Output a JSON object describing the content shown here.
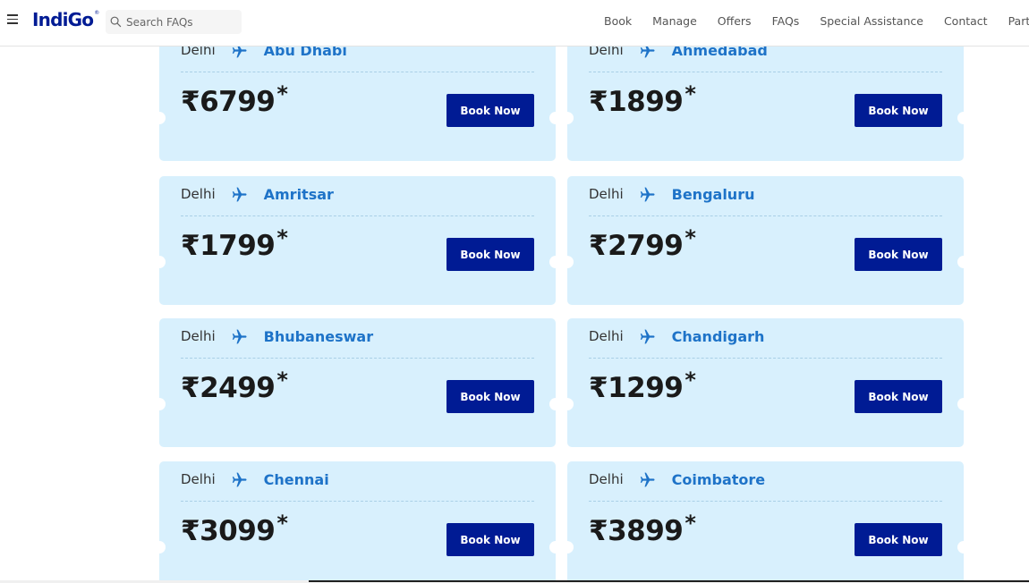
{
  "header": {
    "logo_text": "IndiGo",
    "logo_mark": "®",
    "search": {
      "placeholder": "Search FAQs"
    },
    "nav": [
      "Book",
      "Manage",
      "Offers",
      "FAQs",
      "Special Assistance",
      "Contact",
      "Partner"
    ]
  },
  "deals": [
    {
      "origin": "Delhi",
      "destination": "Abu Dhabi",
      "price": "₹6799",
      "button": "Book Now"
    },
    {
      "origin": "Delhi",
      "destination": "Ahmedabad",
      "price": "₹1899",
      "button": "Book Now"
    },
    {
      "origin": "Delhi",
      "destination": "Amritsar",
      "price": "₹1799",
      "button": "Book Now"
    },
    {
      "origin": "Delhi",
      "destination": "Bengaluru",
      "price": "₹2799",
      "button": "Book Now"
    },
    {
      "origin": "Delhi",
      "destination": "Bhubaneswar",
      "price": "₹2499",
      "button": "Book Now"
    },
    {
      "origin": "Delhi",
      "destination": "Chandigarh",
      "price": "₹1299",
      "button": "Book Now"
    },
    {
      "origin": "Delhi",
      "destination": "Chennai",
      "price": "₹3099",
      "button": "Book Now"
    },
    {
      "origin": "Delhi",
      "destination": "Coimbatore",
      "price": "₹3899",
      "button": "Book Now"
    }
  ],
  "price_suffix": "*",
  "icons": {
    "menu": "hamburger-icon",
    "search": "search-icon",
    "route": "plane-icon"
  },
  "colors": {
    "brand": "#001b94",
    "card_bg": "#d8f0fd",
    "destination": "#1e73c8"
  }
}
